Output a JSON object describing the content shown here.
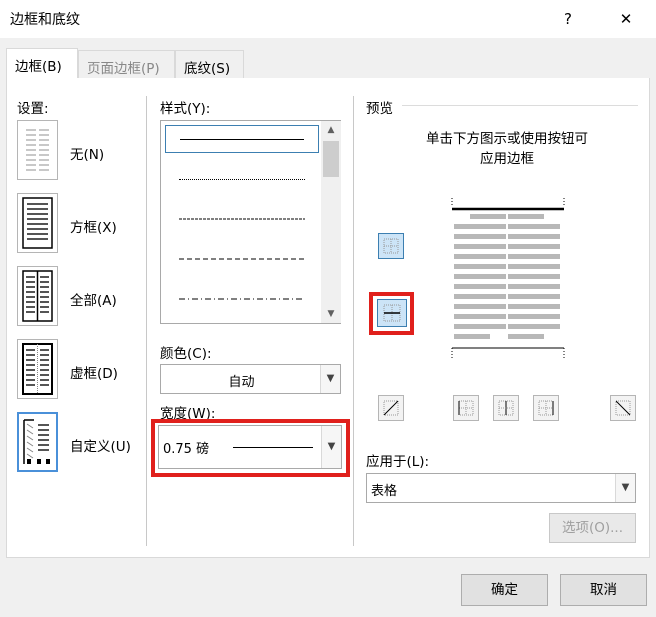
{
  "window": {
    "title": "边框和底纹",
    "help": "?",
    "close": "✕"
  },
  "tabs": [
    {
      "label": "边框(B)",
      "active": true
    },
    {
      "label": "页面边框(P)",
      "active": false
    },
    {
      "label": "底纹(S)",
      "active": false
    }
  ],
  "settings": {
    "header": "设置:",
    "options": [
      {
        "label": "无(N)"
      },
      {
        "label": "方框(X)"
      },
      {
        "label": "全部(A)"
      },
      {
        "label": "虚框(D)"
      },
      {
        "label": "自定义(U)",
        "selected": true
      }
    ]
  },
  "style": {
    "header": "样式(Y):",
    "items": [
      "solid",
      "dotted",
      "dashed-fine",
      "dashed",
      "dash-dot"
    ]
  },
  "color": {
    "label": "颜色(C):",
    "value": "自动"
  },
  "width": {
    "label": "宽度(W):",
    "value": "0.75 磅"
  },
  "preview": {
    "header": "预览",
    "instruction_line1": "单击下方图示或使用按钮可",
    "instruction_line2": "应用边框"
  },
  "apply_to": {
    "label": "应用于(L):",
    "value": "表格"
  },
  "buttons": {
    "options": "选项(O)...",
    "ok": "确定",
    "cancel": "取消"
  },
  "colors": {
    "highlight": "#e0201c",
    "selection": "#4a90d9"
  }
}
